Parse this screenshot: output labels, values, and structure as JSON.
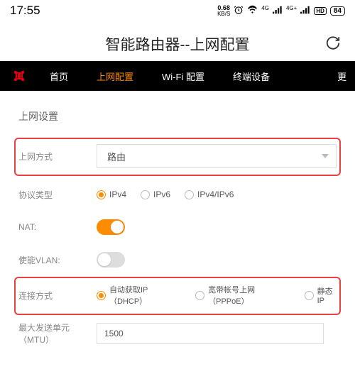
{
  "statusBar": {
    "time": "17:55",
    "kbsTop": "0.68",
    "kbsBot": "KB/S",
    "sig1": "4G",
    "sig2": "4G+",
    "hd": "HD",
    "battery": "84"
  },
  "title": "智能路由器--上网配置",
  "nav": {
    "items": [
      "首页",
      "上网配置",
      "Wi-Fi 配置",
      "终端设备"
    ],
    "more": "更"
  },
  "section": "上网设置",
  "labels": {
    "wanMode": "上网方式",
    "protocol": "协议类型",
    "nat": "NAT:",
    "vlan": "使能VLAN:",
    "connType": "连接方式",
    "mtu": "最大发送单元（MTU）"
  },
  "values": {
    "wanMode": "路由",
    "mtu": "1500"
  },
  "protocolOptions": [
    "IPv4",
    "IPv6",
    "IPv4/IPv6"
  ],
  "connOptions": [
    "自动获取IP（DHCP）",
    "宽带帐号上网（PPPoE）",
    "静态IP"
  ]
}
